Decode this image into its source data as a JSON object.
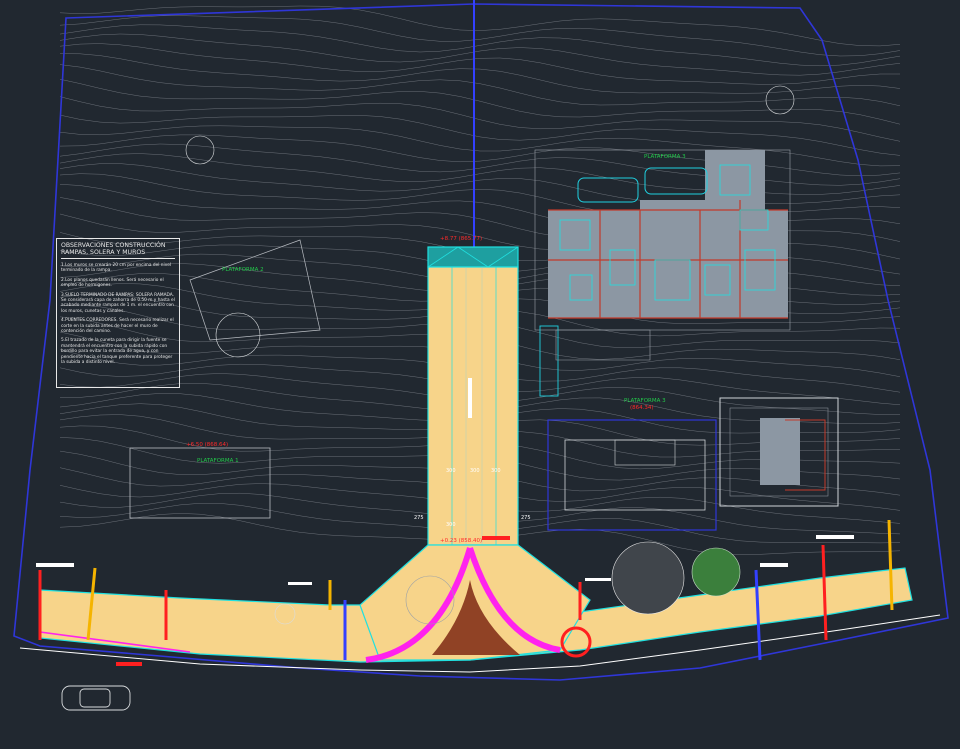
{
  "notes": {
    "title": "OBSERVACIONES CONSTRUCCIÓN RAMPAS, SOLERA Y MUROS",
    "items": [
      "1.Los muros se crearán 20 cm por encima del nivel terminado de la rampa.",
      "2.Los planos quedarán llenos. Será necesario el empleo de hormigones.",
      "3.SUELO TERMINADO DE RAMPAS: SOLERA RAMADA. Se considerará capa de zahorra de 0.50 m y hasta el acabado mediante rampas de 1 m. el encuentro con los muros, cunetas y canales.",
      "4.PUENTES CORREDORES. Será necesario realizar el corte en la subida antes de hacer el muro de contención del camino.",
      "5.El trazado de la cuneta para dirigir la fuente se mantendrá el encuentro con la subida rápido con bordillo para evitar la entrada de agua, y con pendiente hacia el tanque preferente para proteger la subida a distinto nivel."
    ]
  },
  "labels": {
    "plataforma1": "PLATAFORMA 1",
    "plataforma1_level": "+6.50 (868.64)",
    "plataforma2": "PLATAFORMA 2",
    "plataforma3": "PLATAFORMA 3",
    "plataforma_house": "PLATAFORMA 3",
    "plataforma_level": "(864.34)",
    "ramp_top_level": "+8.77 (865.77)",
    "junction_level": "+0.23 (858.40)"
  },
  "dimensions": {
    "d300a": "300",
    "d300b": "300",
    "d300c": "300",
    "d25a": "275",
    "d25b": "275",
    "d300d": "300"
  },
  "colors": {
    "background": "#212830",
    "contour": "#8a8f96",
    "ramp_fill": "#f7d48a",
    "ramp_edge": "#20e0e0",
    "boundary": "#2f36d8",
    "curb": "#ff22ee",
    "accent_red": "#ff2020",
    "house_fill": "#8c97a3",
    "brick": "#8a3a20"
  }
}
